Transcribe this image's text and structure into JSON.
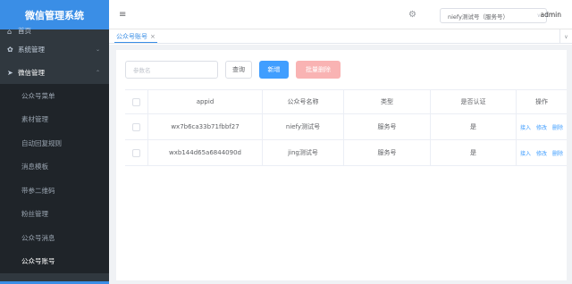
{
  "app": {
    "title": "微信管理系统"
  },
  "sidebar": {
    "items": [
      {
        "label": "首页",
        "icon": "home-icon"
      },
      {
        "label": "系统管理",
        "icon": "gear-icon"
      },
      {
        "label": "微信管理",
        "icon": "send-icon"
      }
    ],
    "sub_items": [
      {
        "label": "公众号菜单"
      },
      {
        "label": "素材管理"
      },
      {
        "label": "自动回复规则"
      },
      {
        "label": "消息模板"
      },
      {
        "label": "带参二维码"
      },
      {
        "label": "粉丝管理"
      },
      {
        "label": "公众号消息"
      },
      {
        "label": "公众号账号",
        "active": true
      }
    ]
  },
  "header": {
    "account_select": "niefy测试号（服务号）",
    "user": "admin"
  },
  "tags": [
    {
      "label": "公众号账号"
    }
  ],
  "toolbar": {
    "search_placeholder": "参数名",
    "query_label": "查询",
    "add_label": "新增",
    "batch_delete_label": "批量删除"
  },
  "table": {
    "columns": [
      "appid",
      "公众号名称",
      "类型",
      "是否认证",
      "操作"
    ],
    "rows": [
      {
        "appid": "wx7b6ca33b71fbbf27",
        "name": "niefy测试号",
        "type": "服务号",
        "verified": "是"
      },
      {
        "appid": "wxb144d65a6844090d",
        "name": "jing测试号",
        "type": "服务号",
        "verified": "是"
      }
    ],
    "row_actions": [
      "接入",
      "修改",
      "删除"
    ]
  },
  "colors": {
    "accent": "#409eff",
    "sidebar": "#30383f",
    "danger_light": "#f9b3b3"
  }
}
